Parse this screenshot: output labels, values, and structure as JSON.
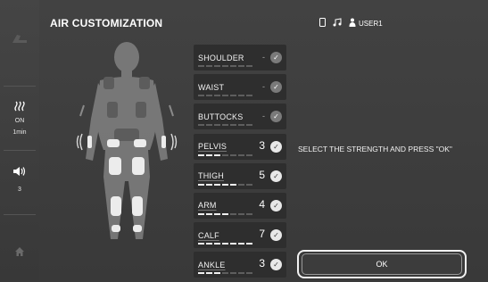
{
  "header": {
    "title": "AIR CUSTOMIZATION",
    "user": "USER1",
    "icons": [
      "phone-icon",
      "music-note-icon",
      "user-icon"
    ]
  },
  "sidebar": {
    "heat": {
      "icon": "heat-waves-icon",
      "state": "ON",
      "time": "1min"
    },
    "volume": {
      "icon": "speaker-icon",
      "level": "3"
    },
    "top_icon": "recline-chair-icon",
    "home_icon": "home-icon"
  },
  "areas": [
    {
      "label": "SHOULDER",
      "value": "-",
      "active": false,
      "level": 0
    },
    {
      "label": "WAIST",
      "value": "-",
      "active": false,
      "level": 0
    },
    {
      "label": "BUTTOCKS",
      "value": "-",
      "active": false,
      "level": 0
    },
    {
      "label": "PELVIS",
      "value": "3",
      "active": true,
      "level": 3
    },
    {
      "label": "THIGH",
      "value": "5",
      "active": true,
      "level": 5
    },
    {
      "label": "ARM",
      "value": "4",
      "active": true,
      "level": 4
    },
    {
      "label": "CALF",
      "value": "7",
      "active": true,
      "level": 7
    },
    {
      "label": "ANKLE",
      "value": "3",
      "active": true,
      "level": 3
    }
  ],
  "max_level": 7,
  "instruction": "SELECT THE STRENGTH AND PRESS \"OK\"",
  "ok_label": "OK",
  "colors": {
    "background": "#3a3a3a",
    "row": "#2e2e2e",
    "text": "#ffffff",
    "check_on": "#e8e8e8",
    "check_off": "#7a7a7a"
  }
}
